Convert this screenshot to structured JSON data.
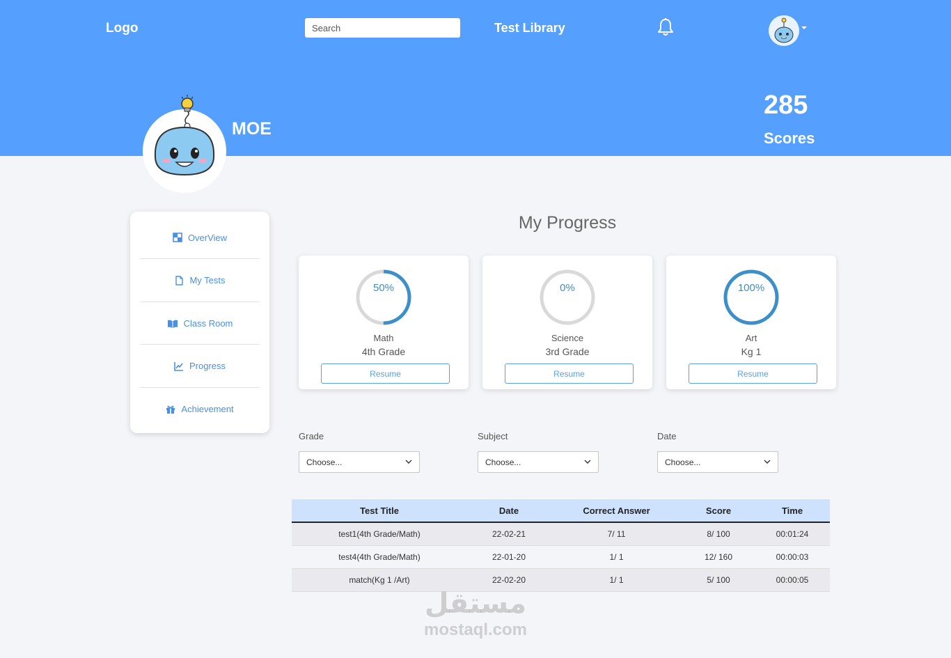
{
  "header": {
    "logo": "Logo",
    "search_placeholder": "Search",
    "nav_link": "Test Library"
  },
  "profile": {
    "name": "MOE",
    "score": "285",
    "score_label": "Scores"
  },
  "sidebar": {
    "items": [
      {
        "label": "OverView",
        "icon": "overview-icon"
      },
      {
        "label": "My Tests",
        "icon": "document-icon"
      },
      {
        "label": "Class Room",
        "icon": "book-icon"
      },
      {
        "label": "Progress",
        "icon": "chart-icon"
      },
      {
        "label": "Achievement",
        "icon": "gift-icon"
      }
    ]
  },
  "main": {
    "title": "My Progress",
    "cards": [
      {
        "percent": "50%",
        "progress": 0.5,
        "subject": "Math",
        "grade": "4th Grade",
        "button": "Resume"
      },
      {
        "percent": "0%",
        "progress": 0,
        "subject": "Science",
        "grade": "3rd Grade",
        "button": "Resume"
      },
      {
        "percent": "100%",
        "progress": 1,
        "subject": "Art",
        "grade": "Kg 1",
        "button": "Resume"
      }
    ],
    "filters": [
      {
        "label": "Grade",
        "value": "Choose..."
      },
      {
        "label": "Subject",
        "value": "Choose..."
      },
      {
        "label": "Date",
        "value": "Choose..."
      }
    ],
    "table": {
      "headers": [
        "Test Title",
        "Date",
        "Correct Answer",
        "Score",
        "Time"
      ],
      "rows": [
        [
          "test1(4th Grade/Math)",
          "22-02-21",
          "7/ 11",
          "8/ 100",
          "00:01:24"
        ],
        [
          "test4(4th Grade/Math)",
          "22-01-20",
          "1/ 1",
          "12/ 160",
          "00:00:03"
        ],
        [
          "match(Kg 1 /Art)",
          "22-02-20",
          "1/ 1",
          "5/ 100",
          "00:00:05"
        ]
      ]
    }
  },
  "watermark": {
    "arabic": "مستقل",
    "latin": "mostaql.com"
  },
  "colors": {
    "header_bg": "#55a0fe",
    "accent": "#3d8fc9",
    "ring_track": "#d9d9d9",
    "table_header_bg": "#cfe2fd"
  }
}
